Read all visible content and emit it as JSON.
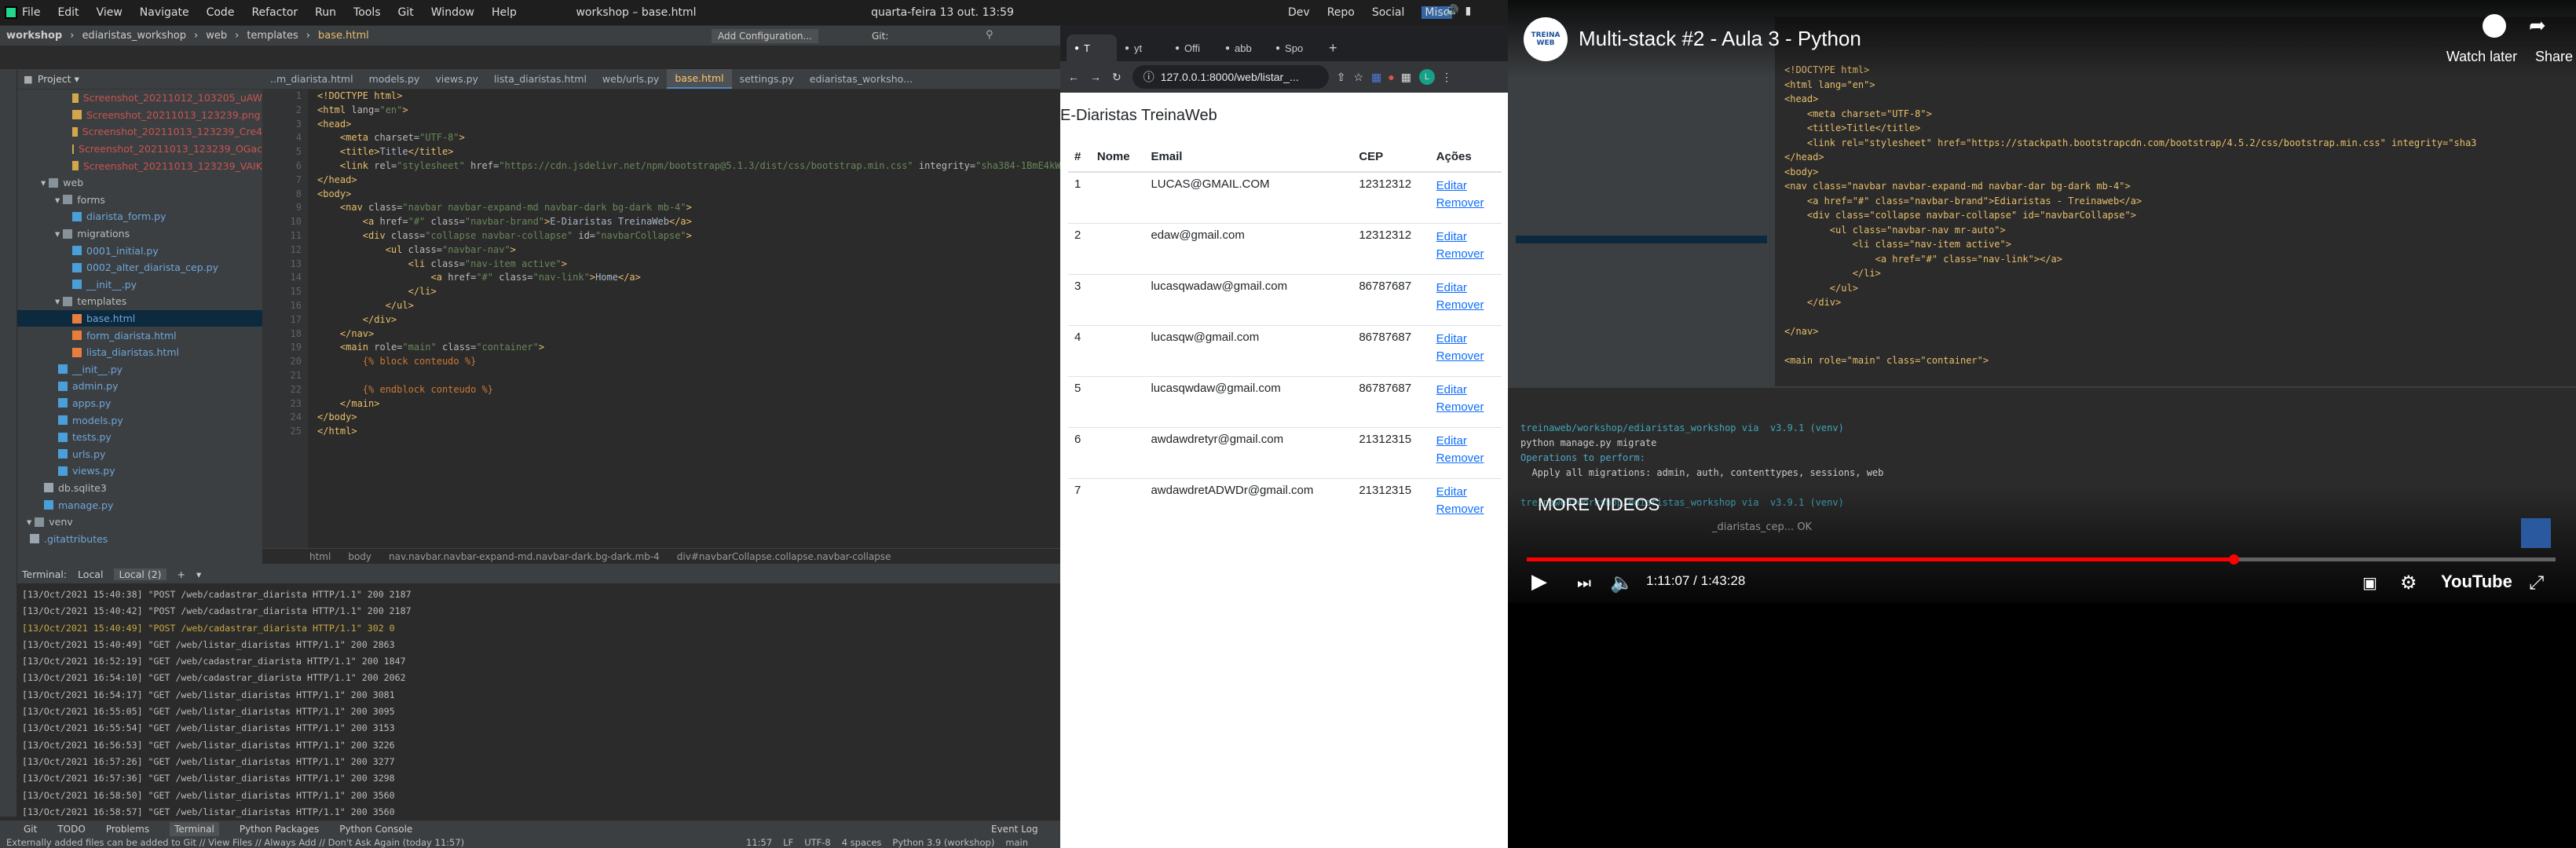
{
  "sysbar": {
    "menu": [
      "File",
      "Edit",
      "View",
      "Navigate",
      "Code",
      "Refactor",
      "Run",
      "Tools",
      "Git",
      "Window",
      "Help"
    ],
    "window_title": "workshop – base.html",
    "datetime": "quarta-feira 13 out. 13:59",
    "right_items": [
      "Dev",
      "Repo",
      "Social",
      "Misc"
    ]
  },
  "ide": {
    "breadcrumb": [
      "workshop",
      "ediaristas_workshop",
      "web",
      "templates",
      "base.html"
    ],
    "run_config": "Add Configuration...",
    "git_label": "Git:",
    "project_label": "Project",
    "tree": [
      {
        "indent": 3,
        "label": "Screenshot_20211012_103205_uAW",
        "kind": "img"
      },
      {
        "indent": 3,
        "label": "Screenshot_20211013_123239.png",
        "kind": "img"
      },
      {
        "indent": 3,
        "label": "Screenshot_20211013_123239_Cre4",
        "kind": "img"
      },
      {
        "indent": 3,
        "label": "Screenshot_20211013_123239_OGac",
        "kind": "img"
      },
      {
        "indent": 3,
        "label": "Screenshot_20211013_123239_VAIK",
        "kind": "img"
      },
      {
        "indent": 1,
        "label": "web",
        "kind": "folder"
      },
      {
        "indent": 2,
        "label": "forms",
        "kind": "folder"
      },
      {
        "indent": 3,
        "label": "diarista_form.py",
        "kind": "py"
      },
      {
        "indent": 2,
        "label": "migrations",
        "kind": "folder"
      },
      {
        "indent": 3,
        "label": "0001_initial.py",
        "kind": "py"
      },
      {
        "indent": 3,
        "label": "0002_alter_diarista_cep.py",
        "kind": "py"
      },
      {
        "indent": 3,
        "label": "__init__.py",
        "kind": "py"
      },
      {
        "indent": 2,
        "label": "templates",
        "kind": "folder"
      },
      {
        "indent": 3,
        "label": "base.html",
        "kind": "html",
        "selected": true
      },
      {
        "indent": 3,
        "label": "form_diarista.html",
        "kind": "html"
      },
      {
        "indent": 3,
        "label": "lista_diaristas.html",
        "kind": "html"
      },
      {
        "indent": 2,
        "label": "__init__.py",
        "kind": "py"
      },
      {
        "indent": 2,
        "label": "admin.py",
        "kind": "py"
      },
      {
        "indent": 2,
        "label": "apps.py",
        "kind": "py"
      },
      {
        "indent": 2,
        "label": "models.py",
        "kind": "py"
      },
      {
        "indent": 2,
        "label": "tests.py",
        "kind": "py"
      },
      {
        "indent": 2,
        "label": "urls.py",
        "kind": "py"
      },
      {
        "indent": 2,
        "label": "views.py",
        "kind": "py"
      },
      {
        "indent": 1,
        "label": "db.sqlite3",
        "kind": "db"
      },
      {
        "indent": 1,
        "label": "manage.py",
        "kind": "py"
      },
      {
        "indent": 0,
        "label": "venv",
        "kind": "folder"
      },
      {
        "indent": 0,
        "label": ".gitattributes",
        "kind": "file"
      }
    ],
    "tabs": [
      "..m_diarista.html",
      "models.py",
      "views.py",
      "lista_diaristas.html",
      "web/urls.py",
      "base.html",
      "settings.py",
      "ediaristas_worksho..."
    ],
    "active_tab": 5,
    "code_lines": [
      [
        {
          "c": "tg",
          "t": "<!DOCTYPE html>"
        }
      ],
      [
        {
          "c": "tg",
          "t": "<html "
        },
        {
          "c": "at",
          "t": "lang="
        },
        {
          "c": "st",
          "t": "\"en\""
        },
        {
          "c": "tg",
          "t": ">"
        }
      ],
      [
        {
          "c": "tg",
          "t": "<head>"
        }
      ],
      [
        {
          "c": "tx",
          "t": "    "
        },
        {
          "c": "tg",
          "t": "<meta "
        },
        {
          "c": "at",
          "t": "charset="
        },
        {
          "c": "st",
          "t": "\"UTF-8\""
        },
        {
          "c": "tg",
          "t": ">"
        }
      ],
      [
        {
          "c": "tx",
          "t": "    "
        },
        {
          "c": "tg",
          "t": "<title>"
        },
        {
          "c": "tx",
          "t": "Title"
        },
        {
          "c": "tg",
          "t": "</title>"
        }
      ],
      [
        {
          "c": "tx",
          "t": "    "
        },
        {
          "c": "tg",
          "t": "<link "
        },
        {
          "c": "at",
          "t": "rel="
        },
        {
          "c": "st",
          "t": "\"stylesheet\" "
        },
        {
          "c": "at",
          "t": "href="
        },
        {
          "c": "st",
          "t": "\"https://cdn.jsdelivr.net/npm/bootstrap@5.1.3/dist/css/bootstrap.min.css\" "
        },
        {
          "c": "at",
          "t": "integrity="
        },
        {
          "c": "st",
          "t": "\"sha384-1BmE4kWBq78"
        }
      ],
      [
        {
          "c": "tg",
          "t": "</head>"
        }
      ],
      [
        {
          "c": "tg",
          "t": "<body>"
        }
      ],
      [
        {
          "c": "tx",
          "t": "    "
        },
        {
          "c": "tg",
          "t": "<nav "
        },
        {
          "c": "at",
          "t": "class="
        },
        {
          "c": "st",
          "t": "\"navbar navbar-expand-md navbar-dark bg-dark mb-4\""
        },
        {
          "c": "tg",
          "t": ">"
        }
      ],
      [
        {
          "c": "tx",
          "t": "        "
        },
        {
          "c": "tg",
          "t": "<a "
        },
        {
          "c": "at",
          "t": "href="
        },
        {
          "c": "st",
          "t": "\"#\" "
        },
        {
          "c": "at",
          "t": "class="
        },
        {
          "c": "st",
          "t": "\"navbar-brand\""
        },
        {
          "c": "tg",
          "t": ">"
        },
        {
          "c": "tx",
          "t": "E-Diaristas TreinaWeb"
        },
        {
          "c": "tg",
          "t": "</a>"
        }
      ],
      [
        {
          "c": "tx",
          "t": "        "
        },
        {
          "c": "tg",
          "t": "<div "
        },
        {
          "c": "at",
          "t": "class="
        },
        {
          "c": "st",
          "t": "\"collapse navbar-collapse\" "
        },
        {
          "c": "at",
          "t": "id="
        },
        {
          "c": "st",
          "t": "\"navbarCollapse\""
        },
        {
          "c": "tg",
          "t": ">"
        }
      ],
      [
        {
          "c": "tx",
          "t": "            "
        },
        {
          "c": "tg",
          "t": "<ul "
        },
        {
          "c": "at",
          "t": "class="
        },
        {
          "c": "st",
          "t": "\"navbar-nav\""
        },
        {
          "c": "tg",
          "t": ">"
        }
      ],
      [
        {
          "c": "tx",
          "t": "                "
        },
        {
          "c": "tg",
          "t": "<li "
        },
        {
          "c": "at",
          "t": "class="
        },
        {
          "c": "st",
          "t": "\"nav-item active\""
        },
        {
          "c": "tg",
          "t": ">"
        }
      ],
      [
        {
          "c": "tx",
          "t": "                    "
        },
        {
          "c": "tg",
          "t": "<a "
        },
        {
          "c": "at",
          "t": "href="
        },
        {
          "c": "st",
          "t": "\"#\" "
        },
        {
          "c": "at",
          "t": "class="
        },
        {
          "c": "st",
          "t": "\"nav-link\""
        },
        {
          "c": "tg",
          "t": ">"
        },
        {
          "c": "tx",
          "t": "Home"
        },
        {
          "c": "tg",
          "t": "</a>"
        }
      ],
      [
        {
          "c": "tx",
          "t": "                "
        },
        {
          "c": "tg",
          "t": "</li>"
        }
      ],
      [
        {
          "c": "tx",
          "t": "            "
        },
        {
          "c": "tg",
          "t": "</ul>"
        }
      ],
      [
        {
          "c": "tx",
          "t": "        "
        },
        {
          "c": "tg",
          "t": "</div>"
        }
      ],
      [
        {
          "c": "tx",
          "t": "    "
        },
        {
          "c": "tg",
          "t": "</nav>"
        }
      ],
      [
        {
          "c": "tx",
          "t": "    "
        },
        {
          "c": "tg",
          "t": "<main "
        },
        {
          "c": "at",
          "t": "role="
        },
        {
          "c": "st",
          "t": "\"main\" "
        },
        {
          "c": "at",
          "t": "class="
        },
        {
          "c": "st",
          "t": "\"container\""
        },
        {
          "c": "tg",
          "t": ">"
        }
      ],
      [
        {
          "c": "tx",
          "t": "        "
        },
        {
          "c": "cm",
          "t": "{% block conteudo %}"
        }
      ],
      [
        {
          "c": "tx",
          "t": ""
        }
      ],
      [
        {
          "c": "tx",
          "t": "        "
        },
        {
          "c": "cm",
          "t": "{% endblock conteudo %}"
        }
      ],
      [
        {
          "c": "tx",
          "t": "    "
        },
        {
          "c": "tg",
          "t": "</main>"
        }
      ],
      [
        {
          "c": "tg",
          "t": "</body>"
        }
      ],
      [
        {
          "c": "tg",
          "t": "</html>"
        }
      ]
    ],
    "editor_crumbs": [
      "html",
      "body",
      "nav.navbar.navbar-expand-md.navbar-dark.bg-dark.mb-4",
      "div#navbarCollapse.collapse.navbar-collapse"
    ],
    "terminal_label": "Terminal:",
    "terminal_tabs": [
      "Local",
      "Local (2)"
    ],
    "terminal_lines": [
      {
        "t": "[13/Oct/2021 15:40:38] \"POST /web/cadastrar_diarista HTTP/1.1\" 200 2187"
      },
      {
        "t": "[13/Oct/2021 15:40:42] \"POST /web/cadastrar_diarista HTTP/1.1\" 200 2187"
      },
      {
        "t": "[13/Oct/2021 15:40:49] \"POST /web/cadastrar_diarista HTTP/1.1\" 302 0",
        "y": true
      },
      {
        "t": "[13/Oct/2021 15:40:49] \"GET /web/listar_diaristas HTTP/1.1\" 200 2863"
      },
      {
        "t": "[13/Oct/2021 16:52:19] \"GET /web/cadastrar_diarista HTTP/1.1\" 200 1847"
      },
      {
        "t": "[13/Oct/2021 16:54:10] \"GET /web/cadastrar_diarista HTTP/1.1\" 200 2062"
      },
      {
        "t": "[13/Oct/2021 16:54:17] \"GET /web/listar_diaristas HTTP/1.1\" 200 3081"
      },
      {
        "t": "[13/Oct/2021 16:55:05] \"GET /web/listar_diaristas HTTP/1.1\" 200 3095"
      },
      {
        "t": "[13/Oct/2021 16:55:54] \"GET /web/listar_diaristas HTTP/1.1\" 200 3153"
      },
      {
        "t": "[13/Oct/2021 16:56:53] \"GET /web/listar_diaristas HTTP/1.1\" 200 3226"
      },
      {
        "t": "[13/Oct/2021 16:57:26] \"GET /web/listar_diaristas HTTP/1.1\" 200 3277"
      },
      {
        "t": "[13/Oct/2021 16:57:36] \"GET /web/listar_diaristas HTTP/1.1\" 200 3298"
      },
      {
        "t": "[13/Oct/2021 16:58:50] \"GET /web/listar_diaristas HTTP/1.1\" 200 3560"
      },
      {
        "t": "[13/Oct/2021 16:58:57] \"GET /web/listar_diaristas HTTP/1.1\" 200 3560"
      },
      {
        "t": "[13/Oct/2021 16:58:59] \"GET /web/listar_diaristas HTTP/1.1\" 200 3560"
      },
      {
        "t": "[13/Oct/2021 16:59:31] \"GET /web/listar_diaristas HTTP/1.1\" 200 3560"
      }
    ],
    "bottom_tools": [
      "Git",
      "TODO",
      "Problems",
      "Terminal",
      "Python Packages",
      "Python Console"
    ],
    "event_log": "Event Log",
    "status_left": "Externally added files can be added to Git // View Files // Always Add // Don't Ask Again (today 11:57)",
    "status_right": [
      "11:57",
      "LF",
      "UTF-8",
      "4 spaces",
      "Python 3.9 (workshop)",
      "main"
    ]
  },
  "browser": {
    "tabs": [
      "T",
      "yt",
      "Offi",
      "abb",
      "Spo"
    ],
    "url": "127.0.0.1:8000/web/listar_...",
    "heading": "E-Diaristas TreinaWeb",
    "columns": [
      "#",
      "Nome",
      "Email",
      "CEP",
      "Ações"
    ],
    "rows": [
      {
        "id": "1",
        "nome": "",
        "email": "LUCAS@GMAIL.COM",
        "cep": "12312312"
      },
      {
        "id": "2",
        "nome": "",
        "email": "edaw@gmail.com",
        "cep": "12312312"
      },
      {
        "id": "3",
        "nome": "",
        "email": "lucasqwadaw@gmail.com",
        "cep": "86787687"
      },
      {
        "id": "4",
        "nome": "",
        "email": "lucasqw@gmail.com",
        "cep": "86787687"
      },
      {
        "id": "5",
        "nome": "",
        "email": "lucasqwdaw@gmail.com",
        "cep": "86787687"
      },
      {
        "id": "6",
        "nome": "",
        "email": "awdawdretyr@gmail.com",
        "cep": "21312315"
      },
      {
        "id": "7",
        "nome": "",
        "email": "awdawdretADWDr@gmail.com",
        "cep": "21312315"
      }
    ],
    "edit_label": "Editar",
    "remove_label": "Remover"
  },
  "video": {
    "title": "Multi-stack #2 - Aula 3 - Python",
    "watch_later": "Watch later",
    "share": "Share",
    "more_videos": "MORE VIDEOS",
    "time": "1:11:07 / 1:43:28",
    "progress": 0.687,
    "youtube": "YouTube",
    "channel_logo": "TREINA WEB",
    "terminal_lines": [
      "treinaweb/workshop/ediaristas_workshop via  v3.9.1 (venv)",
      "python manage.py migrate",
      "Operations to perform:",
      "  Apply all migrations: admin, auth, contenttypes, sessions, web",
      "",
      "treinaweb/workshop/ediaristas_workshop via  v3.9.1 (venv)"
    ],
    "code_lines": [
      "<!DOCTYPE html>",
      "<html lang=\"en\">",
      "<head>",
      "    <meta charset=\"UTF-8\">",
      "    <title>Title</title>",
      "    <link rel=\"stylesheet\" href=\"https://stackpath.bootstrapcdn.com/bootstrap/4.5.2/css/bootstrap.min.css\" integrity=\"sha3",
      "</head>",
      "<body>",
      "<nav class=\"navbar navbar-expand-md navbar-dar bg-dark mb-4\">",
      "    <a href=\"#\" class=\"navbar-brand\">Ediaristas - Treinaweb</a>",
      "    <div class=\"collapse navbar-collapse\" id=\"navbarCollapse\">",
      "        <ul class=\"navbar-nav mr-auto\">",
      "            <li class=\"nav-item active\">",
      "                <a href=\"#\" class=\"nav-link\"></a>",
      "            </li>",
      "        </ul>",
      "    </div>",
      "",
      "</nav>",
      "",
      "<main role=\"main\" class=\"container\">"
    ],
    "migration_line": "_diaristas_cep... OK"
  }
}
